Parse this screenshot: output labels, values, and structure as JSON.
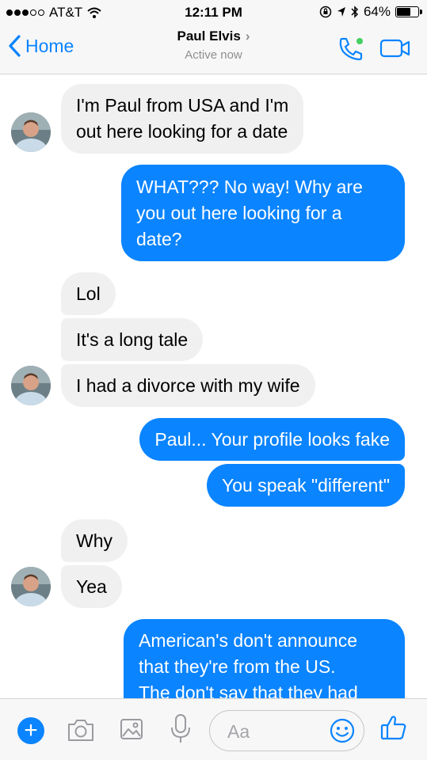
{
  "status_bar": {
    "carrier": "AT&T",
    "time": "12:11 PM",
    "battery_percent": "64%",
    "battery_level": 0.64
  },
  "header": {
    "back_label": "Home",
    "contact_name": "Paul Elvis",
    "contact_status": "Active now"
  },
  "messages": [
    {
      "direction": "incoming",
      "text": "I'm Paul from USA and I'm\nout here looking for a date"
    },
    {
      "direction": "outgoing",
      "text": "WHAT???  No way! Why are\nyou out here looking for a\ndate?"
    },
    {
      "direction": "incoming",
      "text": "Lol"
    },
    {
      "direction": "incoming",
      "text": "It's a long tale"
    },
    {
      "direction": "incoming",
      "text": "I had a divorce with my wife"
    },
    {
      "direction": "outgoing",
      "text": "Paul...  Your profile looks fake"
    },
    {
      "direction": "outgoing",
      "text": "You speak \"different\""
    },
    {
      "direction": "incoming",
      "text": "Why"
    },
    {
      "direction": "incoming",
      "text": "Yea"
    },
    {
      "direction": "outgoing",
      "text": "American's don't announce\nthat they're from the US.\nThe don't say that they had"
    }
  ],
  "composer": {
    "placeholder": "Aa"
  },
  "colors": {
    "accent": "#0a84ff",
    "incoming_bubble": "#f0f0f0",
    "outgoing_bubble": "#0a84ff",
    "secondary_text": "#8e8e93"
  },
  "icons": {
    "back": "chevron-left-icon",
    "call": "phone-icon",
    "video": "video-camera-icon",
    "add": "plus-icon",
    "camera": "camera-icon",
    "gallery": "image-icon",
    "voice": "microphone-icon",
    "emoji": "smiley-icon",
    "like": "thumbs-up-icon"
  }
}
